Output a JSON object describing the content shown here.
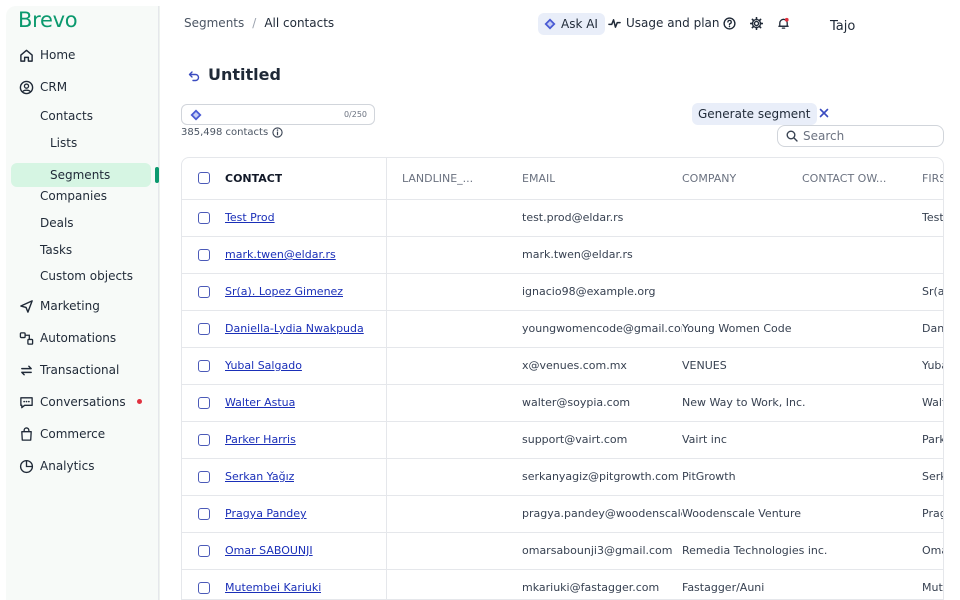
{
  "brand": {
    "logo_text": "Brevo",
    "accent": "#0b996e"
  },
  "sidebar": {
    "items": [
      {
        "label": "Home",
        "icon": "home-icon"
      },
      {
        "label": "CRM",
        "icon": "crm-icon"
      },
      {
        "label": "Marketing",
        "icon": "marketing-icon"
      },
      {
        "label": "Automations",
        "icon": "automations-icon"
      },
      {
        "label": "Transactional",
        "icon": "transactional-icon"
      },
      {
        "label": "Conversations",
        "icon": "conversations-icon"
      },
      {
        "label": "Commerce",
        "icon": "commerce-icon"
      },
      {
        "label": "Analytics",
        "icon": "analytics-icon"
      }
    ],
    "crm_sub": [
      {
        "label": "Contacts"
      },
      {
        "label": "Lists"
      },
      {
        "label": "Segments"
      },
      {
        "label": "Companies"
      },
      {
        "label": "Deals"
      },
      {
        "label": "Tasks"
      },
      {
        "label": "Custom objects"
      }
    ]
  },
  "header": {
    "breadcrumb": [
      "Segments",
      "All contacts"
    ],
    "ask_ai": "Ask AI",
    "usage": "Usage and plan",
    "user": "Tajo"
  },
  "page": {
    "title": "Untitled",
    "segment_counter": "0/250",
    "contacts_count": "385,498 contacts",
    "generate_label": "Generate segment",
    "search_placeholder": "Search"
  },
  "table": {
    "columns": [
      "CONTACT",
      "LANDLINE_...",
      "EMAIL",
      "COMPANY",
      "CONTACT OW...",
      "FIRS"
    ],
    "rows": [
      {
        "name": "Test Prod",
        "email": "test.prod@eldar.rs",
        "company": "",
        "first": "Test"
      },
      {
        "name": "mark.twen@eldar.rs",
        "email": "mark.twen@eldar.rs",
        "company": "",
        "first": ""
      },
      {
        "name": "Sr(a). Lopez Gimenez",
        "email": "ignacio98@example.org",
        "company": "",
        "first": "Sr(a"
      },
      {
        "name": "Daniella-Lydia Nwakpuda",
        "email": "youngwomencode@gmail.com",
        "company": "Young Women Code",
        "first": "Dan"
      },
      {
        "name": "Yubal Salgado",
        "email": "x@venues.com.mx",
        "company": "VENUES",
        "first": "Yuba"
      },
      {
        "name": "Walter Astua",
        "email": "walter@soypia.com",
        "company": "New Way to Work, Inc.",
        "first": "Walt"
      },
      {
        "name": "Parker Harris",
        "email": "support@vairt.com",
        "company": "Vairt inc",
        "first": "Park"
      },
      {
        "name": "Serkan Yağız",
        "email": "serkanyagiz@pitgrowth.com",
        "company": "PitGrowth",
        "first": "Serk"
      },
      {
        "name": "Pragya Pandey",
        "email": "pragya.pandey@woodenscale.in",
        "company": "Woodenscale Venture",
        "first": "Prag"
      },
      {
        "name": "Omar SABOUNJI",
        "email": "omarsabounji3@gmail.com",
        "company": "Remedia Technologies inc.",
        "first": "Oma"
      },
      {
        "name": "Mutembei Kariuki",
        "email": "mkariuki@fastagger.com",
        "company": "Fastagger/Auni",
        "first": "Mute"
      }
    ]
  }
}
